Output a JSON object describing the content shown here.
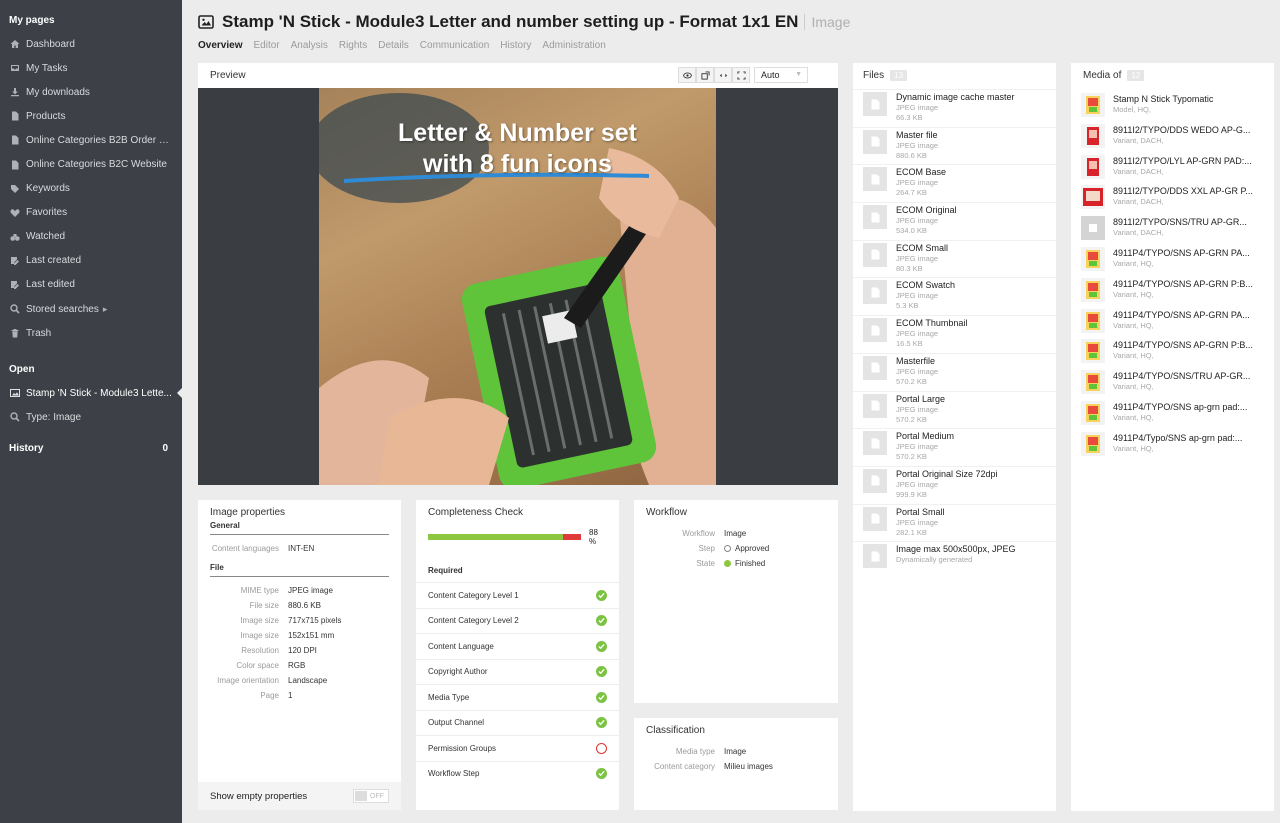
{
  "sidebar": {
    "my_pages_heading": "My pages",
    "items": [
      {
        "label": "Dashboard",
        "icon": "home-icon"
      },
      {
        "label": "My Tasks",
        "icon": "inbox-icon"
      },
      {
        "label": "My downloads",
        "icon": "download-icon"
      },
      {
        "label": "Products",
        "icon": "document-icon"
      },
      {
        "label": "Online Categories B2B Order M...",
        "icon": "document-icon"
      },
      {
        "label": "Online Categories B2C Website",
        "icon": "document-icon"
      },
      {
        "label": "Keywords",
        "icon": "tag-icon"
      },
      {
        "label": "Favorites",
        "icon": "heart-icon"
      },
      {
        "label": "Watched",
        "icon": "binoculars-icon"
      },
      {
        "label": "Last created",
        "icon": "edit-icon"
      },
      {
        "label": "Last edited",
        "icon": "edit-icon"
      },
      {
        "label": "Stored searches",
        "icon": "search-icon"
      },
      {
        "label": "Trash",
        "icon": "trash-icon"
      }
    ],
    "open_heading": "Open",
    "open_items": [
      {
        "label": "Stamp 'N Stick - Module3 Lette...",
        "icon": "image-icon"
      },
      {
        "label": "Type: Image",
        "icon": "search-icon"
      }
    ],
    "history_heading": "History",
    "history_count": "0"
  },
  "header": {
    "title": "Stamp 'N Stick - Module3 Letter and number setting up - Format 1x1 EN",
    "type": "Image",
    "tabs": [
      "Overview",
      "Editor",
      "Analysis",
      "Rights",
      "Details",
      "Communication",
      "History",
      "Administration"
    ]
  },
  "preview": {
    "heading": "Preview",
    "zoom": "Auto",
    "overlay_line1": "Letter & Number set",
    "overlay_line2": "with 8 fun icons"
  },
  "image_properties": {
    "heading": "Image properties",
    "general_label": "General",
    "general": [
      {
        "k": "Content languages",
        "v": "INT-EN"
      }
    ],
    "file_label": "File",
    "file": [
      {
        "k": "MIME type",
        "v": "JPEG image"
      },
      {
        "k": "File size",
        "v": "880.6 KB"
      },
      {
        "k": "Image size",
        "v": "717x715 pixels"
      },
      {
        "k": "Image size",
        "v": "152x151 mm"
      },
      {
        "k": "Resolution",
        "v": "120 DPI"
      },
      {
        "k": "Color space",
        "v": "RGB"
      },
      {
        "k": "Image orientation",
        "v": "Landscape"
      },
      {
        "k": "Page",
        "v": "1"
      }
    ],
    "show_empty_label": "Show empty properties",
    "toggle_label": "OFF"
  },
  "completeness": {
    "heading": "Completeness Check",
    "percent_text": "88 %",
    "percent": 88,
    "required_label": "Required",
    "items": [
      {
        "label": "Content Category Level 1",
        "ok": true
      },
      {
        "label": "Content Category Level 2",
        "ok": true
      },
      {
        "label": "Content Language",
        "ok": true
      },
      {
        "label": "Copyright Author",
        "ok": true
      },
      {
        "label": "Media Type",
        "ok": true
      },
      {
        "label": "Output Channel",
        "ok": true
      },
      {
        "label": "Permission Groups",
        "ok": false
      },
      {
        "label": "Workflow Step",
        "ok": true
      }
    ]
  },
  "workflow": {
    "heading": "Workflow",
    "rows": [
      {
        "k": "Workflow",
        "v": "Image"
      },
      {
        "k": "Step",
        "v": "Approved"
      },
      {
        "k": "State",
        "v": "Finished"
      }
    ]
  },
  "classification": {
    "heading": "Classification",
    "rows": [
      {
        "k": "Media type",
        "v": "Image"
      },
      {
        "k": "Content category",
        "v": "Milieu images"
      }
    ]
  },
  "files": {
    "heading": "Files",
    "count": "13",
    "items": [
      {
        "name": "Dynamic image cache master",
        "type": "JPEG image",
        "size": "66.3 KB"
      },
      {
        "name": "Master file",
        "type": "JPEG image",
        "size": "880.6 KB"
      },
      {
        "name": "ECOM Base",
        "type": "JPEG image",
        "size": "264.7 KB"
      },
      {
        "name": "ECOM Original",
        "type": "JPEG image",
        "size": "534.0 KB"
      },
      {
        "name": "ECOM Small",
        "type": "JPEG image",
        "size": "80.3 KB"
      },
      {
        "name": "ECOM Swatch",
        "type": "JPEG image",
        "size": "5.3 KB"
      },
      {
        "name": "ECOM Thumbnail",
        "type": "JPEG image",
        "size": "16.5 KB"
      },
      {
        "name": "Masterfile",
        "type": "JPEG image",
        "size": "570.2 KB"
      },
      {
        "name": "Portal Large",
        "type": "JPEG image",
        "size": "570.2 KB"
      },
      {
        "name": "Portal Medium",
        "type": "JPEG image",
        "size": "570.2 KB"
      },
      {
        "name": "Portal Original Size 72dpi",
        "type": "JPEG image",
        "size": "999.9 KB"
      },
      {
        "name": "Portal Small",
        "type": "JPEG image",
        "size": "282.1 KB"
      },
      {
        "name": "Image max 500x500px, JPEG",
        "type": "Dynamically generated",
        "size": ""
      }
    ]
  },
  "media_of": {
    "heading": "Media of",
    "count": "12",
    "items": [
      {
        "name": "Stamp N Stick Typomatic",
        "sub": "Model, HQ,",
        "thumb": "product"
      },
      {
        "name": "8911I2/TYPO/DDS WEDO AP-G...",
        "sub": "Variant, DACH,",
        "thumb": "red"
      },
      {
        "name": "8911I2/TYPO/LYL AP-GRN PAD:...",
        "sub": "Variant, DACH,",
        "thumb": "red"
      },
      {
        "name": "8911I2/TYPO/DDS XXL AP-GR P...",
        "sub": "Variant, DACH,",
        "thumb": "redbig"
      },
      {
        "name": "8911I2/TYPO/SNS/TRU AP-GR...",
        "sub": "Variant, DACH,",
        "thumb": "gray"
      },
      {
        "name": "4911P4/TYPO/SNS AP-GRN PA...",
        "sub": "Variant, HQ,",
        "thumb": "product"
      },
      {
        "name": "4911P4/TYPO/SNS AP-GRN P:B...",
        "sub": "Variant, HQ,",
        "thumb": "product"
      },
      {
        "name": "4911P4/TYPO/SNS AP-GRN PA...",
        "sub": "Variant, HQ,",
        "thumb": "product"
      },
      {
        "name": "4911P4/TYPO/SNS AP-GRN P:B...",
        "sub": "Variant, HQ,",
        "thumb": "product"
      },
      {
        "name": "4911P4/TYPO/SNS/TRU AP-GR...",
        "sub": "Variant, HQ,",
        "thumb": "product"
      },
      {
        "name": "4911P4/TYPO/SNS ap-grn pad:...",
        "sub": "Variant, HQ,",
        "thumb": "product"
      },
      {
        "name": "4911P4/Typo/SNS ap-grn pad:...",
        "sub": "Variant, HQ,",
        "thumb": "product"
      }
    ]
  }
}
